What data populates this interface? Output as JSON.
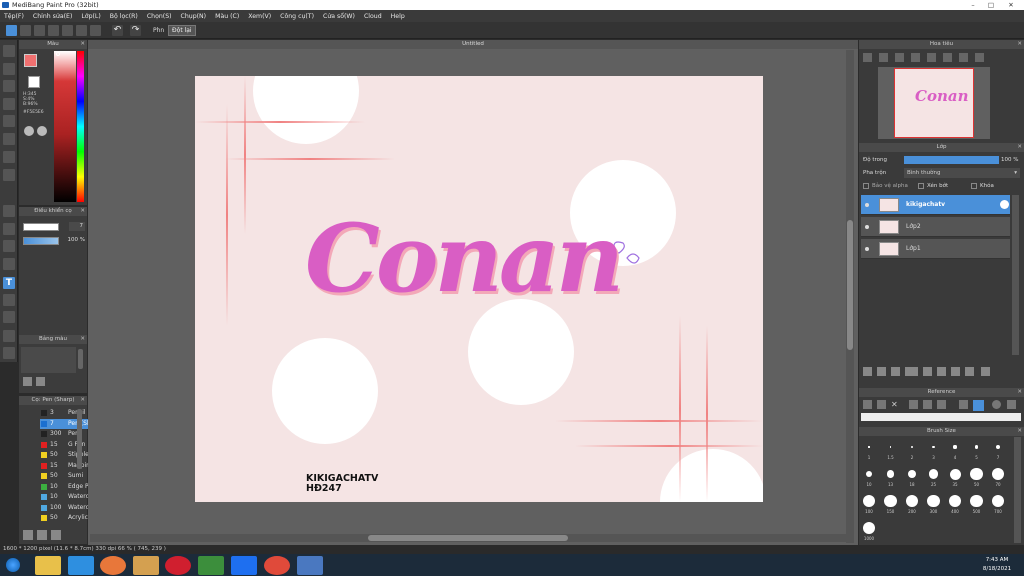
{
  "window": {
    "title": "MediBang Paint Pro (32bit)",
    "minimize": "–",
    "maximize": "□",
    "close": "✕"
  },
  "menu": [
    "Tệp(F)",
    "Chỉnh sửa(E)",
    "Lớp(L)",
    "Bộ lọc(R)",
    "Chọn(S)",
    "Chụp(N)",
    "Màu (C)",
    "Xem(V)",
    "Công cụ(T)",
    "Cửa sổ(W)",
    "Cloud",
    "Help"
  ],
  "toolbar": {
    "prefix_label": "Phn",
    "stabilizer_label": "Đột lại"
  },
  "document": {
    "tab": "Untitled",
    "title_text": "Conan",
    "watermark_line1": "KIKIGACHATV",
    "watermark_line2": "HĐ247"
  },
  "color_panel": {
    "title": "Màu",
    "h": "H:345",
    "s": "S:4%",
    "b": "B:96%",
    "hex": "#F5E5E6",
    "accent": "#f07070"
  },
  "brush_control": {
    "title": "Điều khiển cọ",
    "size": "7",
    "opacity": "100 %"
  },
  "color_list": {
    "title": "Bảng màu"
  },
  "brush_list": {
    "title": "Cọ: Pen (Sharp)",
    "items": [
      {
        "size": "3",
        "name": "Pencil",
        "color": "#222222"
      },
      {
        "size": "7",
        "name": "Pen (Sh",
        "color": "#1a6fd0"
      },
      {
        "size": "300",
        "name": "Pen",
        "color": "#222222"
      },
      {
        "size": "15",
        "name": "G Pen",
        "color": "#e02020"
      },
      {
        "size": "50",
        "name": "Stipple P",
        "color": "#f0d020"
      },
      {
        "size": "15",
        "name": "Mapping",
        "color": "#e02020"
      },
      {
        "size": "50",
        "name": "Sumi",
        "color": "#f0d020"
      },
      {
        "size": "10",
        "name": "Edge Pe",
        "color": "#3cb040"
      },
      {
        "size": "10",
        "name": "Watercol",
        "color": "#50a8e0"
      },
      {
        "size": "100",
        "name": "Watercol",
        "color": "#50a8e0"
      },
      {
        "size": "50",
        "name": "Acrylic",
        "color": "#f0d020"
      }
    ]
  },
  "navigator": {
    "title": "Hoa tiêu"
  },
  "layers_panel": {
    "title": "Lớp",
    "opacity_label": "Độ trong",
    "opacity_value": "100 %",
    "blend_label": "Pha trộn",
    "blend_value": "Bình thường",
    "protect_alpha": "Bảo vệ alpha",
    "clipping": "Xén bớt",
    "lock": "Khóa",
    "layers": [
      {
        "name": "kikigachatv",
        "selected": true
      },
      {
        "name": "Lớp2",
        "selected": false
      },
      {
        "name": "Lớp1",
        "selected": false
      }
    ]
  },
  "reference_panel": {
    "title": "Reference"
  },
  "brush_size_panel": {
    "title": "Brush Size",
    "sizes": [
      "1",
      "1.5",
      "2",
      "3",
      "4",
      "5",
      "7",
      "10",
      "13",
      "18",
      "25",
      "35",
      "50",
      "70",
      "100",
      "150",
      "200",
      "300",
      "400",
      "500",
      "700",
      "1000"
    ]
  },
  "status": {
    "text": "1600 * 1200 pixel  (11.6 * 8.7cm)  330 dpi  66 %  ( 745, 239 )"
  },
  "taskbar": {
    "time": "7:43 AM",
    "date": "8/18/2021"
  }
}
